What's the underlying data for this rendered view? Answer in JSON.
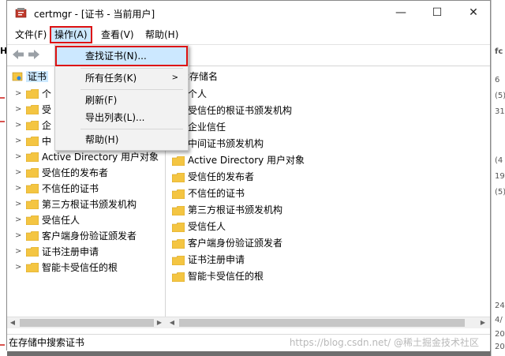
{
  "window": {
    "title": "certmgr - [证书 - 当前用户]"
  },
  "controls": {
    "minimize": "—",
    "maximize": "☐",
    "close": "✕"
  },
  "menubar": [
    {
      "label": "文件(F)"
    },
    {
      "label": "操作(A)"
    },
    {
      "label": "查看(V)"
    },
    {
      "label": "帮助(H)"
    }
  ],
  "action_menu": [
    {
      "label": "查找证书(N)..."
    },
    {
      "label": "所有任务(K)"
    },
    {
      "label": "刷新(F)"
    },
    {
      "label": "导出列表(L)..."
    },
    {
      "label": "帮助(H)"
    }
  ],
  "tree": {
    "root": "证书",
    "items": [
      {
        "label": "个"
      },
      {
        "label": "受"
      },
      {
        "label": "企"
      },
      {
        "label": "中"
      },
      {
        "label": "Active Directory 用户对象"
      },
      {
        "label": "受信任的发布者"
      },
      {
        "label": "不信任的证书"
      },
      {
        "label": "第三方根证书颁发机构"
      },
      {
        "label": "受信任人"
      },
      {
        "label": "客户端身份验证颁发者"
      },
      {
        "label": "证书注册申请"
      },
      {
        "label": "智能卡受信任的根"
      }
    ]
  },
  "content": {
    "header": "辑存储名",
    "items": [
      {
        "label": "个人"
      },
      {
        "label": "受信任的根证书颁发机构"
      },
      {
        "label": "企业信任"
      },
      {
        "label": "中间证书颁发机构"
      },
      {
        "label": "Active Directory 用户对象"
      },
      {
        "label": "受信任的发布者"
      },
      {
        "label": "不信任的证书"
      },
      {
        "label": "第三方根证书颁发机构"
      },
      {
        "label": "受信任人"
      },
      {
        "label": "客户端身份验证颁发者"
      },
      {
        "label": "证书注册申请"
      },
      {
        "label": "智能卡受信任的根"
      }
    ]
  },
  "status": {
    "text": "在存储中搜索证书"
  },
  "watermark": "https://blog.csdn.net/ @稀土掘金技术社区",
  "background_right": [
    "6",
    "(5)",
    "31",
    "(4",
    "19",
    "(5)",
    "24",
    "4/",
    "20",
    "20"
  ],
  "background_left_top": "H",
  "background_right_top": "fc",
  "colors": {
    "highlight": "#cce8ff",
    "red_outline": "#dd1111",
    "folder": "#f4c542"
  }
}
